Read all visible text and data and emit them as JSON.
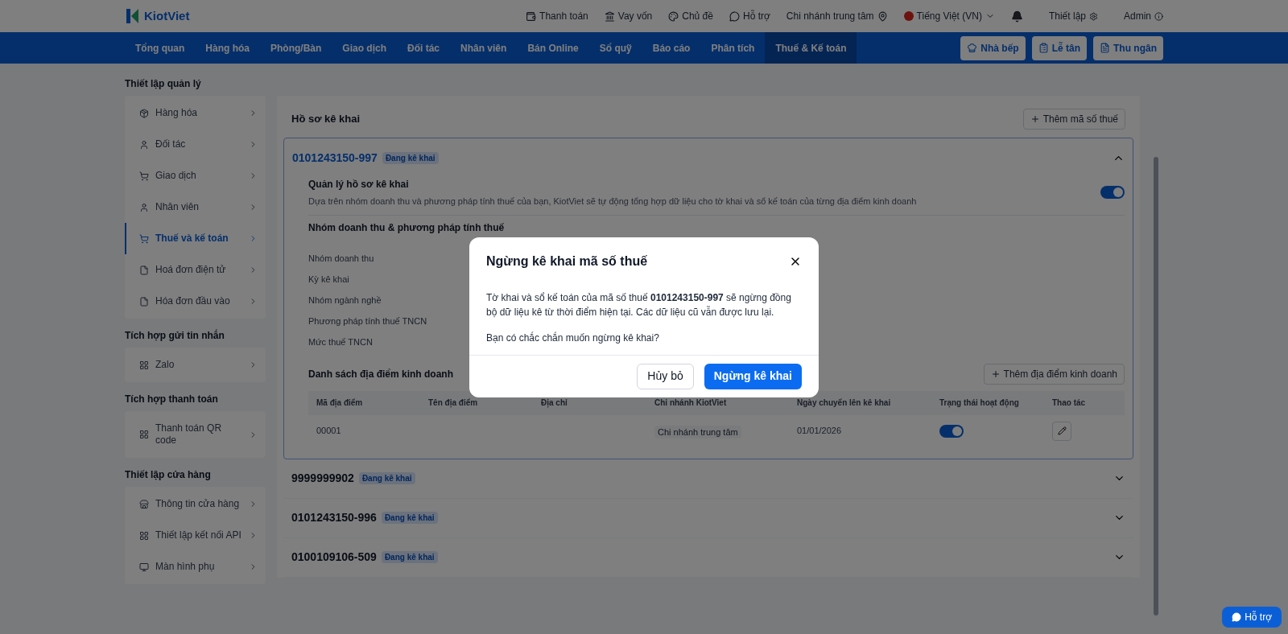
{
  "header": {
    "logo": "KiotViet",
    "links": [
      {
        "label": "Thanh toán",
        "kind": "wallet"
      },
      {
        "label": "Vay vốn",
        "kind": "money"
      },
      {
        "label": "Chủ đề",
        "kind": "theme"
      },
      {
        "label": "Hỗ trợ",
        "kind": "chat"
      }
    ],
    "branch": "Chi nhánh trung tâm",
    "language": "Tiếng Việt (VN)",
    "settings": "Thiết lập",
    "user": "Admin"
  },
  "nav": {
    "items": [
      {
        "label": "Tổng quan",
        "selected": false
      },
      {
        "label": "Hàng hóa",
        "selected": false
      },
      {
        "label": "Phòng/Bàn",
        "selected": false
      },
      {
        "label": "Giao dịch",
        "selected": false
      },
      {
        "label": "Đối tác",
        "selected": false
      },
      {
        "label": "Nhân viên",
        "selected": false
      },
      {
        "label": "Bán Online",
        "selected": false
      },
      {
        "label": "Sổ quỹ",
        "selected": false
      },
      {
        "label": "Báo cáo",
        "selected": false
      },
      {
        "label": "Phân tích",
        "selected": false
      },
      {
        "label": "Thuế & Kế toán",
        "selected": true
      }
    ],
    "buttons": [
      {
        "label": "Nhà bếp",
        "kind": "kitchen"
      },
      {
        "label": "Lễ tân",
        "kind": "desk"
      },
      {
        "label": "Thu ngân",
        "kind": "cashier"
      }
    ]
  },
  "sidebar": {
    "sections": [
      {
        "title": "Thiết lập quản lý",
        "items": [
          {
            "label": "Hàng hóa",
            "kind": "box",
            "selected": false
          },
          {
            "label": "Đối tác",
            "kind": "user",
            "selected": false
          },
          {
            "label": "Giao dịch",
            "kind": "cart",
            "selected": false
          },
          {
            "label": "Nhân viên",
            "kind": "user",
            "selected": false
          },
          {
            "label": "Thuế và kế toán",
            "kind": "cart",
            "selected": true
          },
          {
            "label": "Hoá đơn điện tử",
            "kind": "file",
            "selected": false
          },
          {
            "label": "Hóa đơn đầu vào",
            "kind": "file",
            "selected": false
          }
        ]
      },
      {
        "title": "Tích hợp gửi tin nhắn",
        "items": [
          {
            "label": "Zalo",
            "kind": "grid",
            "selected": false
          }
        ]
      },
      {
        "title": "Tích hợp thanh toán",
        "items": [
          {
            "label": "Thanh toán QR code",
            "kind": "grid",
            "selected": false
          }
        ]
      },
      {
        "title": "Thiết lập cửa hàng",
        "items": [
          {
            "label": "Thông tin cửa hàng",
            "kind": "store",
            "selected": false
          },
          {
            "label": "Thiết lập kết nối API",
            "kind": "grid",
            "selected": false
          },
          {
            "label": "Màn hình phụ",
            "kind": "monitor",
            "selected": false
          }
        ]
      }
    ]
  },
  "main": {
    "title": "Hồ sơ kê khai",
    "add_button": "Thêm mã số thuế",
    "profiles": [
      {
        "code": "0101243150-997",
        "status": "Đang kê khai",
        "expanded": true,
        "manage_title": "Quản lý hồ sơ kê khai",
        "manage_desc": "Dựa trên nhóm doanh thu và phương pháp tính thuế của bạn, KiotViet sẽ tự động tổng hợp dữ liệu cho tờ khai và sổ kế toán của từng địa điểm kinh doanh",
        "manage_on": true,
        "group_title": "Nhóm doanh thu & phương pháp tính thuế",
        "fields": [
          "Nhóm doanh thu",
          "Kỳ kê khai",
          "Nhóm ngành nghề",
          "Phương pháp tính thuế TNCN",
          "Mức thuế TNCN"
        ],
        "locations_title": "Danh sách địa điểm kinh doanh",
        "add_location": "Thêm địa điểm kinh doanh",
        "columns": [
          "Mã địa điểm",
          "Tên địa điểm",
          "Địa chỉ",
          "Chi nhánh KiotViet",
          "Ngày chuyển lên kê khai",
          "Trạng thái hoạt động",
          "Thao tác"
        ],
        "rows": [
          {
            "code": "00001",
            "branch": "Chi nhánh trung tâm",
            "date": "01/01/2026",
            "on": true
          }
        ]
      },
      {
        "code": "9999999902",
        "status": "Đang kê khai",
        "expanded": false
      },
      {
        "code": "0101243150-996",
        "status": "Đang kê khai",
        "expanded": false
      },
      {
        "code": "0100109106-509",
        "status": "Đang kê khai",
        "expanded": false
      }
    ]
  },
  "help_button": "Hỗ trợ",
  "dialog": {
    "title": "Ngừng kê khai mã số thuế",
    "message": "Tờ khai và sổ kế toán của mã số thuế **0101243150-997** sẽ ngừng đồng bộ dữ liệu kê từ thời điểm hiện tại. Các dữ liệu cũ vẫn được lưu lại.",
    "question": "Bạn có chắc chắn muốn ngừng kê khai?",
    "cancel": "Hủy bỏ",
    "confirm": "Ngừng kê khai"
  }
}
